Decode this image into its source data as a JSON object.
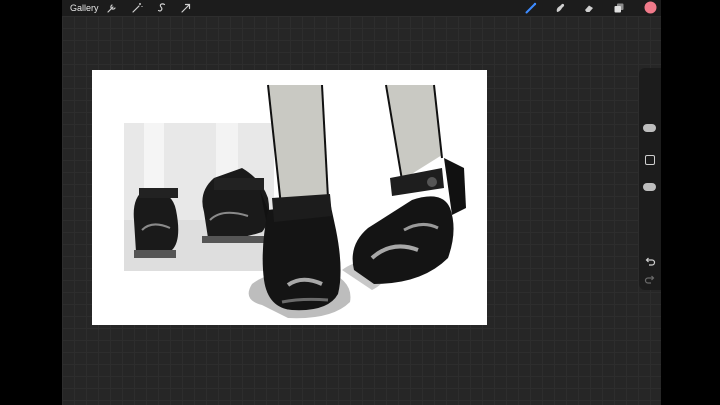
{
  "topbar": {
    "gallery_label": "Gallery",
    "left_tools": [
      "wrench-icon",
      "magic-wand-icon",
      "selection-icon",
      "transform-arrow-icon"
    ],
    "right_tools": [
      "brush-icon",
      "smudge-icon",
      "eraser-icon",
      "layers-icon",
      "color-swatch"
    ],
    "active_tool_color": "#3d8bff",
    "current_color": "#f07a8a"
  },
  "sidebar": {
    "controls": [
      "brush-size-slider",
      "modify-button",
      "opacity-slider",
      "undo-icon",
      "redo-icon"
    ]
  },
  "colors": {
    "app_bg": "#262626",
    "bar_bg": "#1c1c1c",
    "canvas_bg": "#ffffff"
  }
}
